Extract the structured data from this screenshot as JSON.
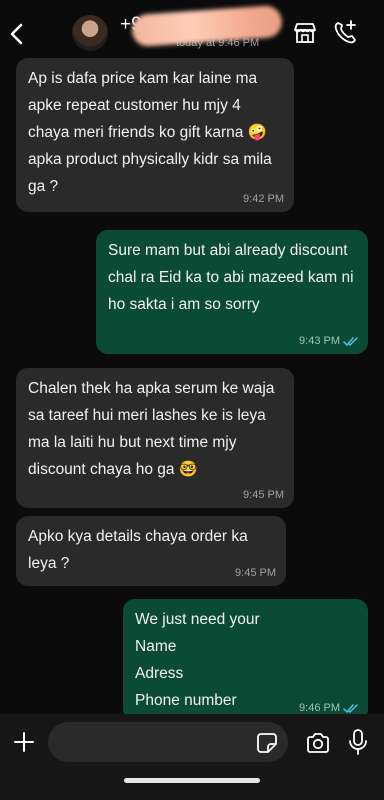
{
  "header": {
    "back_icon": "chevron-left-icon",
    "contact_name": "+9",
    "last_seen": "today at 9:46 PM",
    "catalog_icon": "storefront-icon",
    "call_icon": "phone-plus-icon"
  },
  "messages": [
    {
      "direction": "in",
      "text": "Ap is dafa price kam kar laine ma apke repeat customer hu mjy 4 chaya meri friends ko gift karna 🤪 apka product physically kidr sa mila ga ?",
      "time": "9:42 PM"
    },
    {
      "direction": "out",
      "text": "Sure mam but abi already discount chal ra Eid ka to abi mazeed kam ni ho sakta i am so sorry",
      "time": "9:43 PM",
      "read": true
    },
    {
      "direction": "in",
      "text": "Chalen thek ha apka serum ke waja sa tareef hui meri lashes ke is leya ma la laiti hu but next time mjy discount chaya ho ga 🤓",
      "time": "9:45 PM"
    },
    {
      "direction": "in",
      "text": "Apko kya details chaya order ka leya ?",
      "time": "9:45 PM"
    },
    {
      "direction": "out",
      "text": "We just need your\nName\nAdress\nPhone number",
      "time": "9:46 PM",
      "read": true
    }
  ],
  "composer": {
    "placeholder": "",
    "plus_icon": "plus-icon",
    "sticker_icon": "sticker-icon",
    "camera_icon": "camera-icon",
    "mic_icon": "microphone-icon"
  },
  "colors": {
    "incoming_bubble": "#2a2a2a",
    "outgoing_bubble": "#0b4b35",
    "read_tick": "#53bdeb",
    "background": "#0b0b0b"
  }
}
